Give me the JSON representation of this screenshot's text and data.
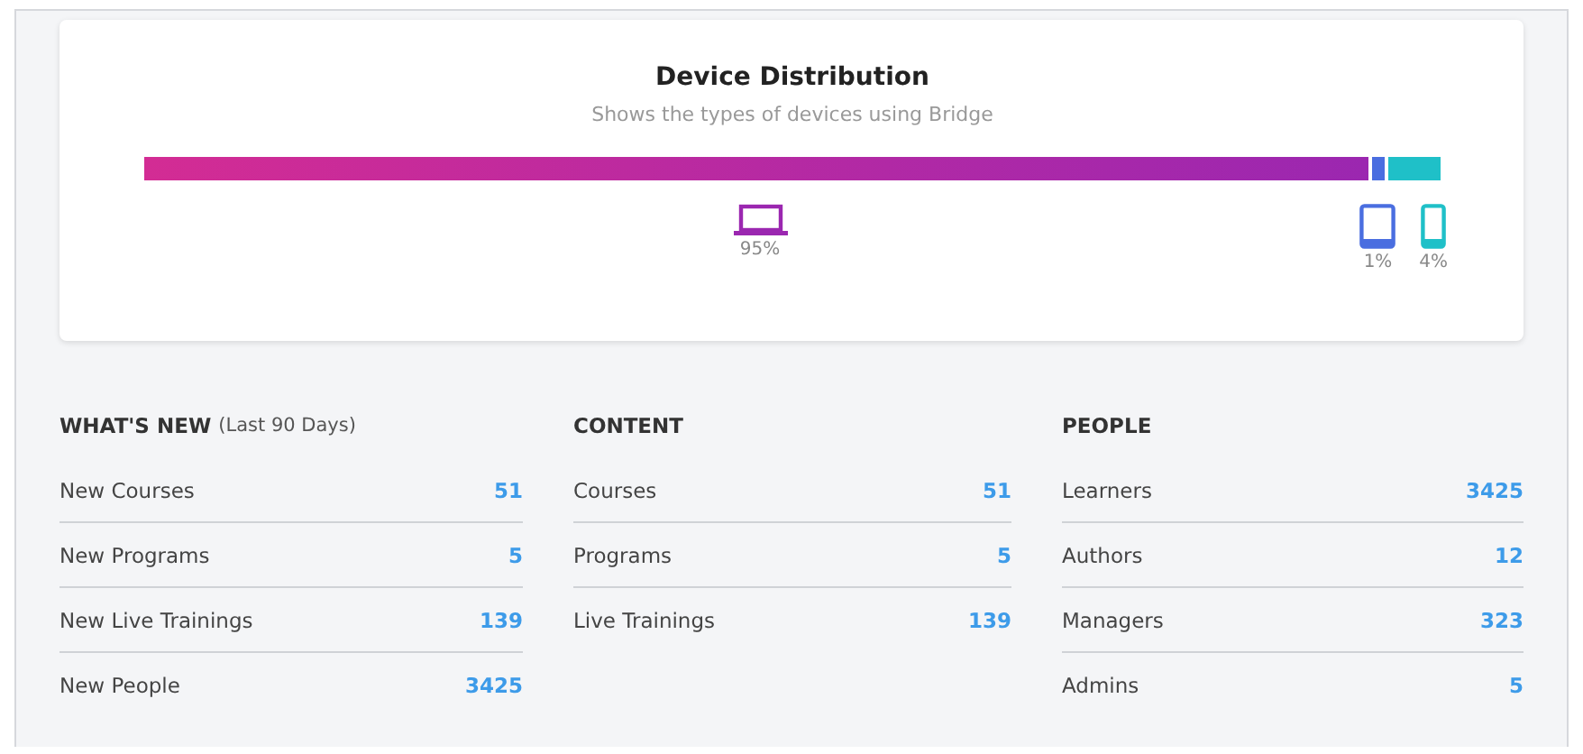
{
  "device_card": {
    "title": "Device Distribution",
    "subtitle": "Shows the types of devices using Bridge",
    "segments": [
      {
        "kind": "laptop",
        "color": "#9b27b0",
        "reading": "95%"
      },
      {
        "kind": "tablet",
        "color": "#4a6ee0",
        "reading": "1%"
      },
      {
        "kind": "phone",
        "color": "#1fc0c8",
        "reading": "4%"
      }
    ]
  },
  "sections": [
    {
      "title": "WHAT'S NEW",
      "note": "(Last 90 Days)",
      "rows": [
        {
          "label": "New Courses",
          "value": "51"
        },
        {
          "label": "New Programs",
          "value": "5"
        },
        {
          "label": "New Live Trainings",
          "value": "139"
        },
        {
          "label": "New People",
          "value": "3425"
        }
      ]
    },
    {
      "title": "CONTENT",
      "rows": [
        {
          "label": "Courses",
          "value": "51"
        },
        {
          "label": "Programs",
          "value": "5"
        },
        {
          "label": "Live Trainings",
          "value": "139"
        }
      ]
    },
    {
      "title": "PEOPLE",
      "rows": [
        {
          "label": "Learners",
          "value": "3425"
        },
        {
          "label": "Authors",
          "value": "12"
        },
        {
          "label": "Managers",
          "value": "323"
        },
        {
          "label": "Admins",
          "value": "5"
        }
      ]
    }
  ]
}
